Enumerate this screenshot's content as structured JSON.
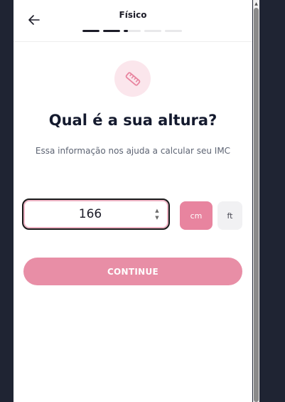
{
  "header": {
    "title": "Físico",
    "back_icon": "arrow-left-icon",
    "progress": [
      1,
      1,
      0.25,
      0,
      0
    ]
  },
  "main": {
    "icon": "ruler-icon",
    "title": "Qual é a sua altura?",
    "subtitle": "Essa informação nos ajuda a calcular seu IMC",
    "height_value": "166",
    "spinner_up": "▲",
    "spinner_down": "▼",
    "units": [
      {
        "label": "cm",
        "selected": true
      },
      {
        "label": "ft",
        "selected": false
      }
    ],
    "continue_label": "CONTINUE"
  },
  "colors": {
    "accent": "#e88ea6",
    "accent_light": "#fbe6ec",
    "text_dark": "#141a2e",
    "page_bg": "#1f2433"
  },
  "scrollbar": {
    "up_arrow": "▲"
  }
}
